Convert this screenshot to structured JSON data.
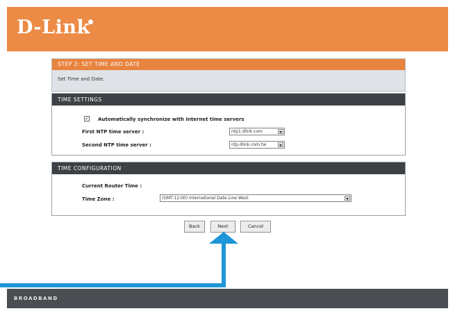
{
  "brand": {
    "logo_text": "D-Link",
    "footer_text": "BROADBAND"
  },
  "step": {
    "title": "STEP 2: SET TIME AND DATE",
    "description": "Set Time and Date."
  },
  "time_settings": {
    "header": "TIME SETTINGS",
    "auto_sync_label": "Automatically synchronize with Internet time servers",
    "auto_sync_checked": true,
    "first_ntp_label": "First NTP time server :",
    "first_ntp_value": "ntp1.dlink.com",
    "second_ntp_label": "Second NTP time server :",
    "second_ntp_value": "ntp.dlink.com.tw"
  },
  "time_config": {
    "header": "TIME CONFIGURATION",
    "current_time_label": "Current Router Time :",
    "timezone_label": "Time Zone :",
    "timezone_value": "(GMT-12:00) International Date Line West"
  },
  "buttons": {
    "back": "Back",
    "next": "Next",
    "cancel": "Cancel"
  },
  "colors": {
    "header_bg": "#ec8b45",
    "panel_header_bg": "#3d4146",
    "arrow": "#1e96d8",
    "footer_bg": "#4a4d51"
  }
}
